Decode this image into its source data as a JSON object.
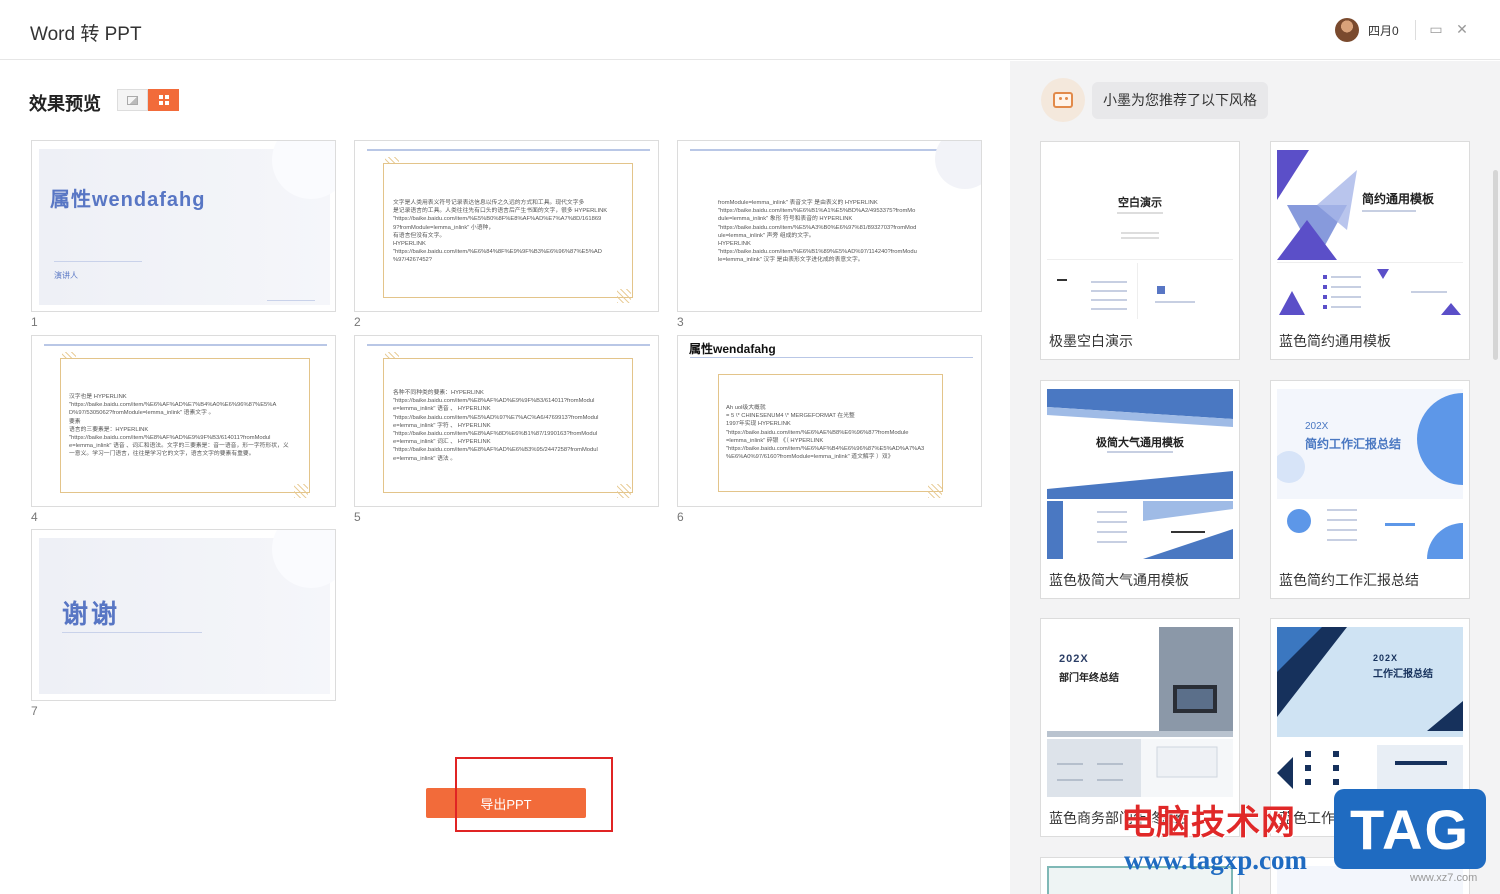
{
  "window": {
    "title": "Word 转 PPT",
    "user_name": "四月0"
  },
  "preview": {
    "heading": "效果预览",
    "slides": [
      {
        "number": "1",
        "title": "属性wendafahg",
        "speaker": "演讲人"
      },
      {
        "number": "2",
        "text": "文字是人类用表义符号记录表达信息以传之久远的方式和工具。现代文字多\n是记录语言的工具。人类往往先有口头的语言后产生书面的文字，很多 HYPERLINK\n\"https://baike.baidu.com/item/%E5%B0%8F%E8%AF%AD%E7%A7%8D/161869\n9?fromModule=lemma_inlink\" 小语种，\n有语言但没有文字。\nHYPERLINK\n\"https://baike.baidu.com/item/%E6%84%8F%E9%9F%B3%E6%96%87%E5%AD\n%97/4267452?"
      },
      {
        "number": "3",
        "text": "fromModule=lemma_inlink\" 表音文字 是由表义的 HYPERLINK\n\"https://baike.baidu.com/item/%E6%B1%A1%E5%BD%A2/4953375?fromMo\ndule=lemma_inlink\" 象形 符号和表音的 HYPERLINK\n\"https://baike.baidu.com/item/%E5%A3%B0%E6%97%81/8932703?fromMod\nule=lemma_inlink\" 声旁 组成的文字。\nHYPERLINK\n\"https://baike.baidu.com/item/%E6%B1%89%E5%AD%97/114240?fromModu\nle=lemma_inlink\" 汉字 是由表形文字进化成的表意文字。"
      },
      {
        "number": "4",
        "text": "汉字也是 HYPERLINK\n\"https://baike.baidu.com/item/%E6%AF%AD%E7%B4%A0%E6%96%87%E5%A\nD%97/5305062?fromModule=lemma_inlink\" 语素文字 。\n要素\n语言的三要素是：HYPERLINK\n\"https://baike.baidu.com/item/%E8%AF%AD%E9%9F%B3/614011?fromModul\ne=lemma_inlink\" 语音 、词汇和语法。文字的三要素是：音一语音，形一字符形状，义\n一意义。学习一门语言，往往是学习它的文字，语言文字的要素有重要。"
      },
      {
        "number": "5",
        "text": "各种不同种类的要素：HYPERLINK\n\"https://baike.baidu.com/item/%E8%AF%AD%E9%9F%B3/614011?fromModul\ne=lemma_inlink\" 语音 、 HYPERLINK\n\"https://baike.baidu.com/item/%E5%AD%97%E7%AC%A6/4769913?fromModul\ne=lemma_inlink\" 字符 、 HYPERLINK\n\"https://baike.baidu.com/item/%E8%AF%8D%E6%B1%87/1990163?fromModul\ne=lemma_inlink\" 词汇 、 HYPERLINK\n\"https://baike.baidu.com/item/%E8%AF%AD%E6%B3%95/2447258?fromModul\ne=lemma_inlink\" 语法 。"
      },
      {
        "number": "6",
        "title": "属性wendafahg",
        "text": "Ah uol级大概就\n= 5 \\* CHINESENUM4 \\* MERGEFORMAT 在光整\n1997年实现 HYPERLINK\n\"https://baike.baidu.com/item/%E6%AE%B8%E6%96%87?fromModule\n=lemma_inlink\" 碎银 《（ HYPERLINK\n\"https://baike.baidu.com/item/%E6%AF%B4%E6%96%87%E5%AD%A7%A3\n%E6%A0%97/6160?fromModule=lemma_inlink\" 道文解字 ）双》"
      },
      {
        "number": "7",
        "title": "谢谢"
      }
    ],
    "export_button": "导出PPT"
  },
  "recommend": {
    "message": "小墨为您推荐了以下风格",
    "templates": [
      {
        "label": "极墨空白演示",
        "thumb_title": "空白演示"
      },
      {
        "label": "蓝色简约通用模板",
        "thumb_title": "简约通用模板"
      },
      {
        "label": "蓝色极简大气通用模板",
        "thumb_title": "极简大气通用模板"
      },
      {
        "label": "蓝色简约工作汇报总结",
        "thumb_year": "202X",
        "thumb_title": "简约工作汇报总结"
      },
      {
        "label": "蓝色商务部门年终总结",
        "thumb_year": "202X",
        "thumb_title": "部门年终总结"
      },
      {
        "label": "蓝色工作汇报总结",
        "thumb_year": "202X",
        "thumb_title": "工作汇报总结"
      }
    ]
  },
  "watermark": {
    "site_name": "电脑技术网",
    "url": "www.tagxp.com",
    "tag": "TAG",
    "sub": "www.xz7.com"
  },
  "colors": {
    "accent": "#f26b3a",
    "slide_blue": "#5876c4",
    "highlight_red": "#e02424"
  }
}
